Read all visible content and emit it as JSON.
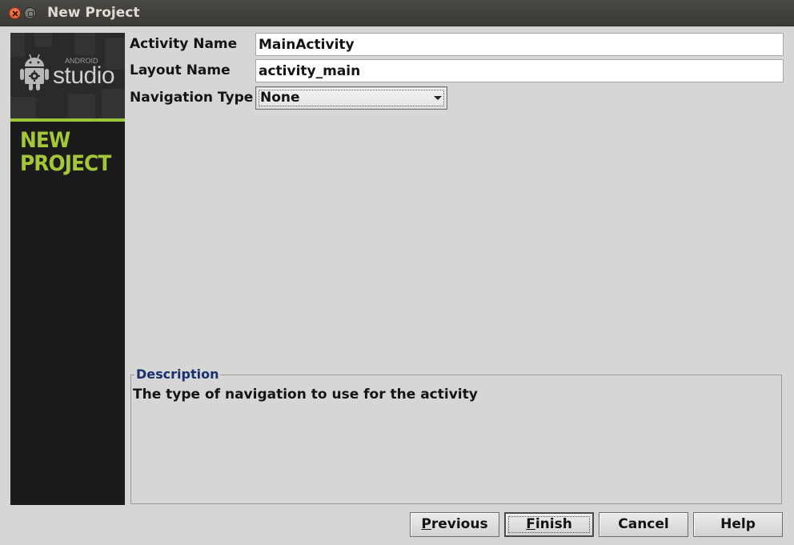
{
  "window": {
    "title": "New Project",
    "close_icon": "close-icon",
    "maximize_icon": "maximize-icon"
  },
  "banner": {
    "logo_icon": "android-robot-icon",
    "logo_small_text": "ANDROID",
    "logo_text": "studio",
    "heading_line1": "NEW",
    "heading_line2": "PROJECT",
    "accent_color": "#a4c639"
  },
  "form": {
    "activity_name": {
      "label": "Activity Name",
      "value": "MainActivity"
    },
    "layout_name": {
      "label": "Layout Name",
      "value": "activity_main"
    },
    "navigation_type": {
      "label": "Navigation Type",
      "selected": "None",
      "arrow_icon": "dropdown-arrow-icon"
    }
  },
  "description": {
    "legend": "Description",
    "text": "The type of navigation to use for the activity"
  },
  "buttons": {
    "previous": {
      "mnemonic": "P",
      "rest": "revious"
    },
    "finish": {
      "mnemonic": "F",
      "rest": "inish"
    },
    "cancel": {
      "label": "Cancel"
    },
    "help": {
      "label": "Help"
    }
  }
}
